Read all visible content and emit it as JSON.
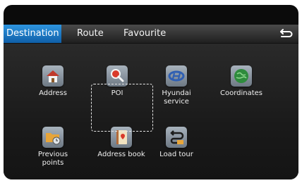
{
  "tabs": {
    "destination": "Destination",
    "route": "Route",
    "favourite": "Favourite"
  },
  "items": [
    {
      "label": "Address",
      "icon": "house-icon"
    },
    {
      "label": "POI",
      "icon": "poi-magnifier-icon"
    },
    {
      "label": "Hyundai service",
      "icon": "hyundai-logo-icon"
    },
    {
      "label": "Coordinates",
      "icon": "globe-icon"
    },
    {
      "label": "Previous points",
      "icon": "folder-history-icon"
    },
    {
      "label": "Address book",
      "icon": "address-book-icon"
    },
    {
      "label": "Load tour",
      "icon": "load-tour-icon"
    }
  ],
  "colors": {
    "active_tab": "#1a7fd0",
    "icon_gray": "#8f9aa6"
  }
}
